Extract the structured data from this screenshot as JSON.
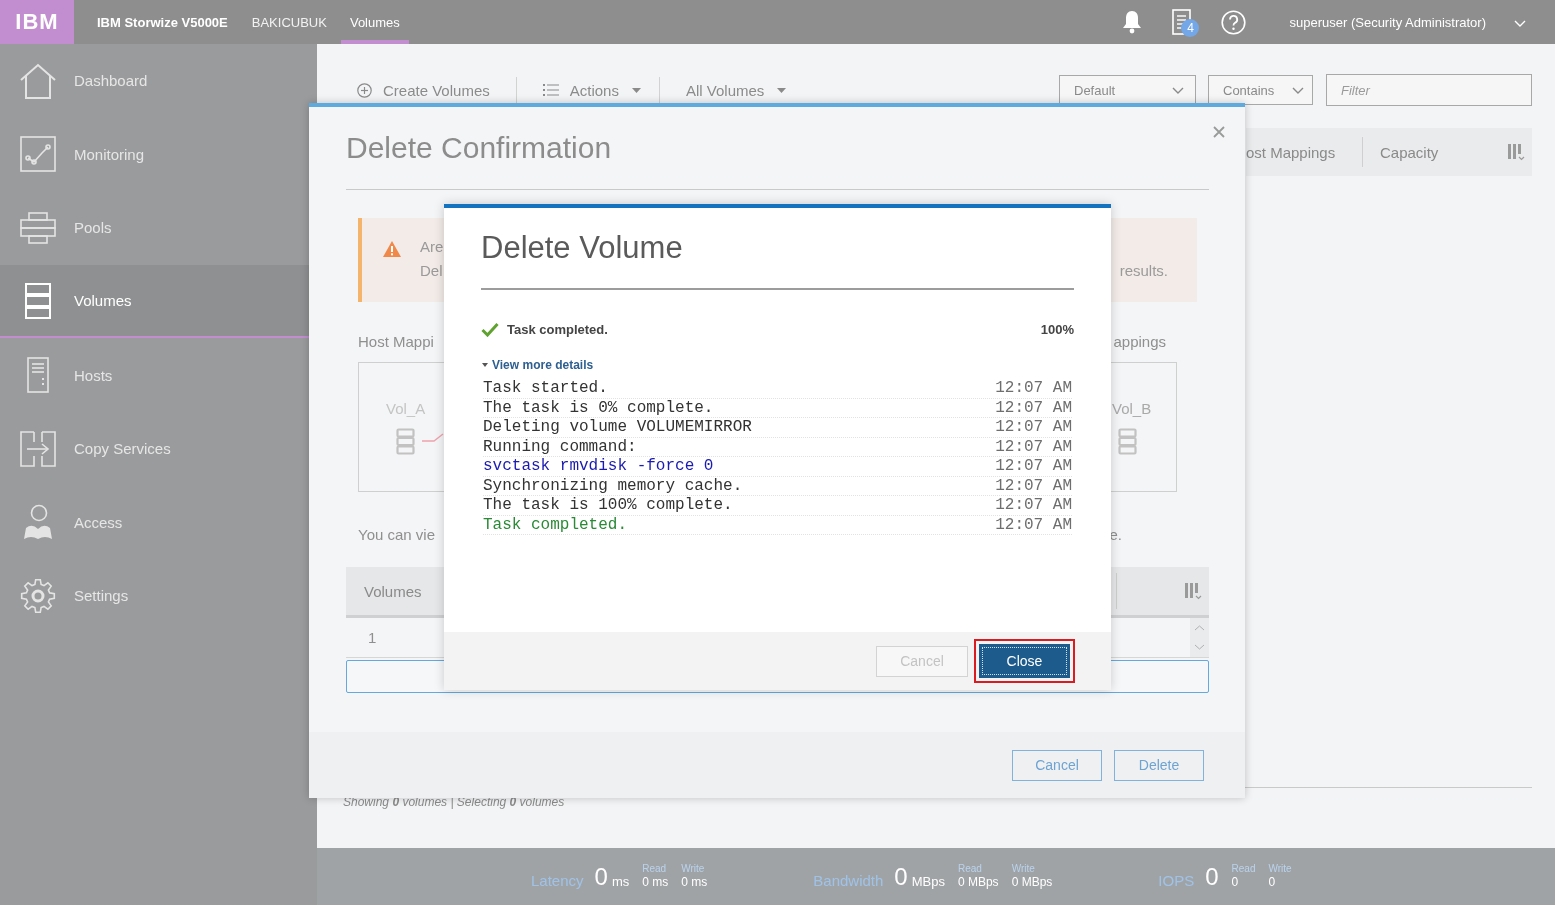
{
  "top_bar": {
    "logo": "IBM",
    "product": "IBM Storwize V5000E",
    "system": "BAKICUBUK",
    "tabs": [
      {
        "label": "Volumes",
        "selected": true
      }
    ],
    "tasks_badge": "4",
    "user": "superuser (Security Administrator)"
  },
  "sidebar": {
    "items": [
      {
        "label": "Dashboard",
        "selected": false
      },
      {
        "label": "Monitoring",
        "selected": false
      },
      {
        "label": "Pools",
        "selected": false
      },
      {
        "label": "Volumes",
        "selected": true
      },
      {
        "label": "Hosts",
        "selected": false
      },
      {
        "label": "Copy Services",
        "selected": false
      },
      {
        "label": "Access",
        "selected": false
      },
      {
        "label": "Settings",
        "selected": false
      }
    ]
  },
  "toolbar": {
    "actions": [
      {
        "label": "Create Volumes",
        "kind": "create"
      },
      {
        "label": "Actions",
        "kind": "menu"
      },
      {
        "label": "All Volumes",
        "kind": "dropdown"
      }
    ],
    "view_select": "Default",
    "match_select": "Contains",
    "filter": {
      "placeholder": "Filter"
    }
  },
  "volumes_table": {
    "columns": [
      "ost Mappings",
      "Capacity"
    ],
    "summary": "Showing **0** volumes | Selecting **0** volumes"
  },
  "status_bar": {
    "metrics": [
      {
        "label": "Latency",
        "value": "0",
        "unit": "ms",
        "read_label": "Read",
        "read": "0 ms",
        "write_label": "Write",
        "write": "0 ms"
      },
      {
        "label": "Bandwidth",
        "value": "0",
        "unit": "MBps",
        "read_label": "Read",
        "read": "0 MBps",
        "write_label": "Write",
        "write": "0 MBps"
      },
      {
        "label": "IOPS",
        "value": "0",
        "read_label": "Read",
        "read": "0",
        "write_label": "Write",
        "write": "0"
      }
    ]
  },
  "delete_confirmation": {
    "title": "Delete Confirmation",
    "warning": {
      "lines": [
        "Are",
        "Del"
      ],
      "tail": "results."
    },
    "mappings_label": "Host Mappi",
    "mappings_label_tail": "appings",
    "mapping": {
      "source": "Vol_A",
      "target": "Vol_B"
    },
    "note": "You can vie",
    "note_tail": "e.",
    "table": {
      "columns": [
        "Volumes"
      ],
      "rows": [
        [
          "1"
        ]
      ]
    },
    "buttons": [
      "Cancel",
      "Delete"
    ]
  },
  "delete_volume": {
    "title": "Delete Volume",
    "status": "Task completed.",
    "progress": "100%",
    "details": {
      "label": "View more details",
      "expanded": true
    },
    "log": [
      {
        "text": "Task started.",
        "time": "12:07 AM",
        "kind": "info"
      },
      {
        "text": "The task is 0% complete.",
        "time": "12:07 AM",
        "kind": "info"
      },
      {
        "text": "Deleting volume VOLUMEMIRROR",
        "time": "12:07 AM",
        "kind": "info"
      },
      {
        "text": "Running command:",
        "time": "12:07 AM",
        "kind": "info"
      },
      {
        "text": "svctask rmvdisk -force 0",
        "time": "12:07 AM",
        "kind": "command"
      },
      {
        "text": "Synchronizing memory cache.",
        "time": "12:07 AM",
        "kind": "info"
      },
      {
        "text": "The task is 100% complete.",
        "time": "12:07 AM",
        "kind": "info"
      },
      {
        "text": "Task completed.",
        "time": "12:07 AM",
        "kind": "success"
      }
    ],
    "buttons": [
      {
        "label": "Cancel",
        "kind": "secondary",
        "disabled": true,
        "highlighted": false
      },
      {
        "label": "Close",
        "kind": "primary",
        "disabled": false,
        "highlighted": true
      }
    ]
  }
}
